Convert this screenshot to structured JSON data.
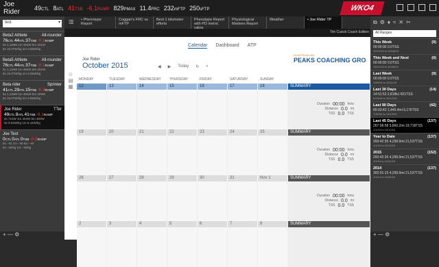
{
  "topbar": {
    "athlete": "Joe Rider",
    "metrics": [
      {
        "value": "49",
        "unit": "CTL",
        "red": false
      },
      {
        "value": "8",
        "unit": "ATL",
        "red": false
      },
      {
        "value": "41",
        "unit": "TSB",
        "red": true
      },
      {
        "value": "-6.1",
        "unit": "RAMP",
        "red": true
      },
      {
        "value": "829",
        "unit": "PMAX",
        "red": false
      },
      {
        "value": "11.4",
        "unit": "FRC",
        "red": false
      },
      {
        "value": "232",
        "unit": "mFTP",
        "red": false
      },
      {
        "value": "250",
        "unit": "sFTP",
        "red": false
      }
    ],
    "logo": "WKO4"
  },
  "left": {
    "search": "test",
    "athletes": [
      {
        "name": "Beta2 Athlete",
        "type": "All-rounder",
        "ctl": "76",
        "atl": "44",
        "tsb": "37",
        "ramp": "-8.1",
        "sub1": "5s 1,119W 1m 494W 5m 321W",
        "sub2": "5s 15.07W/kg 1m 6.65W/kg",
        "active": false
      },
      {
        "name": "Beta5 Athlete",
        "type": "All-rounder",
        "ctl": "76",
        "atl": "44",
        "tsb": "37",
        "ramp": "-8.1",
        "sub1": "5s 1,119W 1m 494W 5m 321W",
        "sub2": "5s 15.07W/kg 1m 6.65W/kg",
        "active": false
      },
      {
        "name": "Beta rider",
        "type": "Sprinter",
        "ctl": "41",
        "atl": "29",
        "tsb": "15",
        "ramp": "-6.9",
        "sub1": "5s 1,119W 1m 494W 5m 329W",
        "sub2": "5s 15.07W/kg 1m 6.65W/kg",
        "active": false
      },
      {
        "name": "Joe Rider",
        "type": "TTer",
        "ctl": "49",
        "atl": "8",
        "tsb": "41",
        "ramp": "-6.1",
        "sub1": "5s 715W 1m 404W 5m 300W",
        "sub2": "5s 9.64W/kg 1m 5.44W/kg",
        "active": true
      },
      {
        "name": "Joe Test",
        "type": "",
        "ctl": "0",
        "atl": "0",
        "tsb": "0",
        "ramp": "-0.8",
        "sub1": "5s --W 1m --W 5m --W",
        "sub2": "5s --W/kg 1m --W/kg",
        "active": false
      }
    ],
    "footer": "+ — ⚙"
  },
  "tabs": [
    {
      "label": "• Phenotype Report",
      "active": false
    },
    {
      "label": "Coggan's FRC vs mFTP",
      "active": false
    },
    {
      "label": "Best 1 kilometer efforts",
      "active": false
    },
    {
      "label": "Phenotype Report with PD metric ratios",
      "active": false
    },
    {
      "label": "Physiological Markers Report",
      "active": false
    },
    {
      "label": "Weather",
      "active": false
    },
    {
      "label": "• Joe Rider TP",
      "active": true
    }
  ],
  "coach": "Tim Cusick  Coach Edition",
  "calendar": {
    "tabs": [
      "Calendar",
      "Dashboard",
      "ATP"
    ],
    "name": "Joe Rider",
    "month": "October  2015",
    "today": "Today",
    "brand_top": "HUNTER ALLEN",
    "brand": "PEAKS COACHING GRO",
    "days": [
      "MONDAY",
      "TUESDAY",
      "WEDNESDAY",
      "THURSDAY",
      "FRIDAY",
      "SATURDAY",
      "SUNDAY"
    ],
    "summary_label": "SUMMARY",
    "weeks": [
      {
        "nums": [
          "12",
          "13",
          "14",
          "15",
          "16",
          "17",
          "18"
        ],
        "duration": "00:00",
        "distance": "0.0",
        "tss": "0.0"
      },
      {
        "nums": [
          "19",
          "20",
          "21",
          "22",
          "23",
          "24",
          "25"
        ],
        "duration": "00:00",
        "distance": "0.0",
        "tss": "0.0"
      },
      {
        "nums": [
          "26",
          "27",
          "28",
          "29",
          "30",
          "31",
          "Nov 1"
        ],
        "duration": "00:00",
        "distance": "0.0",
        "tss": "0.0"
      },
      {
        "nums": [
          "2",
          "3",
          "4",
          "5",
          "6",
          "7",
          "8"
        ],
        "duration": "",
        "distance": "",
        "tss": ""
      }
    ],
    "labels": {
      "duration": "Duration",
      "distance": "Distance",
      "tss": "TSS",
      "dur_unit": "hms",
      "dist_unit": "mi",
      "tss_unit": "TSS"
    }
  },
  "right": {
    "select": "All Ranges",
    "ranges": [
      {
        "name": "This Week",
        "count": "(0)",
        "vals": "00:00:00   0.0TSS",
        "date": "10/12/15  to  10/18/15",
        "active": false
      },
      {
        "name": "This Week and Next",
        "count": "(0)",
        "vals": "00:00:00   0.0TSS",
        "date": "10/12/15  to  10/25/15",
        "active": false
      },
      {
        "name": "Last Week",
        "count": "(0)",
        "vals": "00:00:00   0.0TSS",
        "date": "10/5/15  to  10/11/15",
        "active": false
      },
      {
        "name": "Last 30 Days",
        "count": "(14)",
        "vals": "14:51:53   2,818kJ   821TSS",
        "date": "9/13/15  to  10/12/15",
        "active": false
      },
      {
        "name": "Last 90 Days",
        "count": "(42)",
        "vals": "80:03:43   1,445.4mi   5,176TSS",
        "date": "7/15/15  to  10/12/15",
        "active": false
      },
      {
        "name": "Last 45 Days",
        "count": "(137)",
        "vals": "267:06:58   3,860.2mi   19,718TSS",
        "date": "1/1/15  to  10/12/15",
        "active": true
      },
      {
        "name": "Year to Date",
        "count": "(137)",
        "vals": "293:42:35   4,299.9mi   21,537TSS",
        "date": "1/1/15  to  10/12/15",
        "active": false
      },
      {
        "name": "2015",
        "count": "(152)",
        "vals": "293:42:35   4,299.9mi   21,537TSS",
        "date": "1/1/15  to  12/31/15",
        "active": false
      },
      {
        "name": "2014",
        "count": "(137)",
        "vals": "302:01:15   4,299.9mi   21,537TSS",
        "date": "1/1/14  to  12/31/14",
        "active": false
      }
    ],
    "footer": "+ — ⚙"
  }
}
